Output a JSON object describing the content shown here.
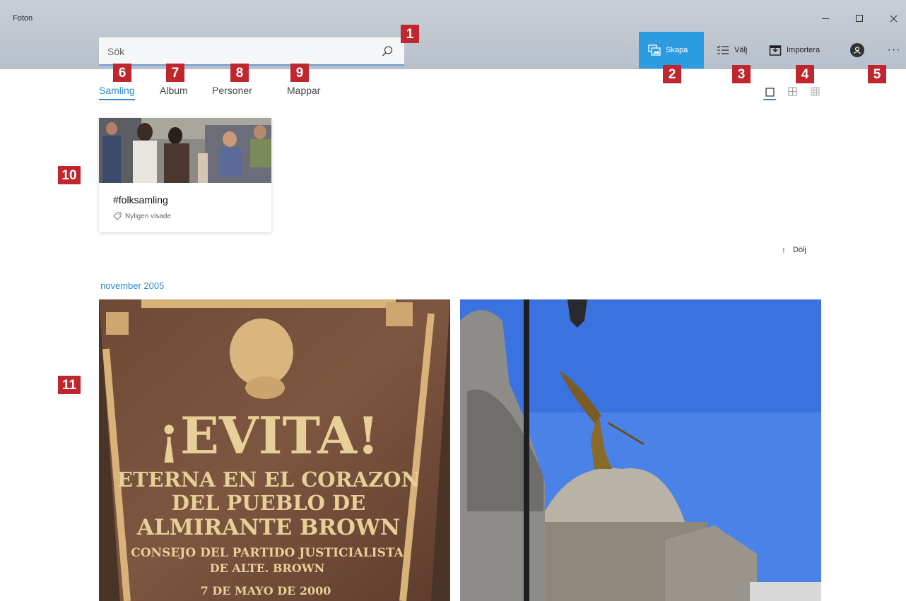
{
  "window": {
    "title": "Foton",
    "minimize": "minimize",
    "maximize": "maximize",
    "close": "close"
  },
  "search": {
    "placeholder": "Sök"
  },
  "toolbar": {
    "create_label": "Skapa",
    "select_label": "Välj",
    "import_label": "Importera",
    "more_label": "···",
    "accent_color": "#2d9be0"
  },
  "nav": {
    "tabs": [
      {
        "label": "Samling",
        "active": true
      },
      {
        "label": "Album",
        "active": false
      },
      {
        "label": "Personer",
        "active": false
      },
      {
        "label": "Mappar",
        "active": false
      }
    ]
  },
  "view_modes": [
    "large",
    "medium",
    "small"
  ],
  "album": {
    "name": "#folksamling",
    "subtitle": "Nyligen visade"
  },
  "hide_label": "Dölj",
  "timeline": {
    "date_header": "november 2005",
    "photos": [
      {
        "content": "¡EVITA! plaque",
        "lines": [
          "¡EVITA!",
          "ETERNA EN EL CORAZON",
          "DEL PUEBLO DE",
          "ALMIRANTE BROWN",
          "CONSEJO DEL PARTIDO JUSTICIALISTA",
          "DE ALTE. BROWN",
          "7 DE MAYO DE 2000"
        ]
      },
      {
        "content": "Cemetery domes with angel statue"
      }
    ]
  },
  "callouts": [
    "1",
    "2",
    "3",
    "4",
    "5",
    "6",
    "7",
    "8",
    "9",
    "10",
    "11"
  ]
}
